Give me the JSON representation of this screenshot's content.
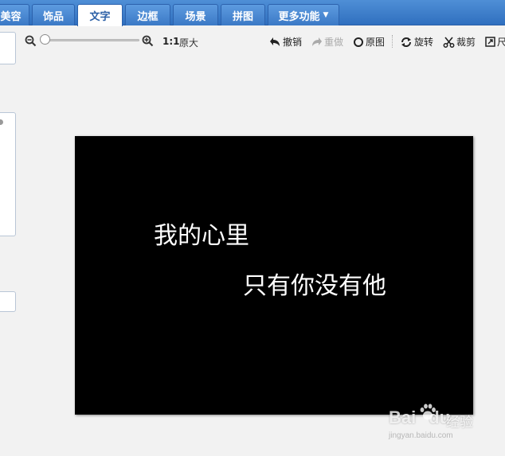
{
  "tabs": [
    {
      "label": "美容",
      "active": false
    },
    {
      "label": "饰品",
      "active": false
    },
    {
      "label": "文字",
      "active": true
    },
    {
      "label": "边框",
      "active": false
    },
    {
      "label": "场景",
      "active": false
    },
    {
      "label": "拼图",
      "active": false
    },
    {
      "label": "更多功能",
      "active": false
    }
  ],
  "toolbar": {
    "zoom_level": 0,
    "ratio_label": "1:1",
    "original_size_label": "原大",
    "undo_label": "撤销",
    "redo_label": "重做",
    "original_label": "原图",
    "rotate_label": "旋转",
    "crop_label": "裁剪",
    "resize_label": "尺"
  },
  "canvas": {
    "background": "#000000",
    "lines": [
      "我的心里",
      "只有你没有他"
    ],
    "text_color": "#ffffff"
  },
  "watermark": {
    "brand": "Bai",
    "brand_suffix": "du",
    "cn": "经验",
    "url": "jingyan.baidu.com"
  },
  "colors": {
    "tabbar": "#2f6fbf",
    "active_tab_text": "#2a5fa6"
  }
}
